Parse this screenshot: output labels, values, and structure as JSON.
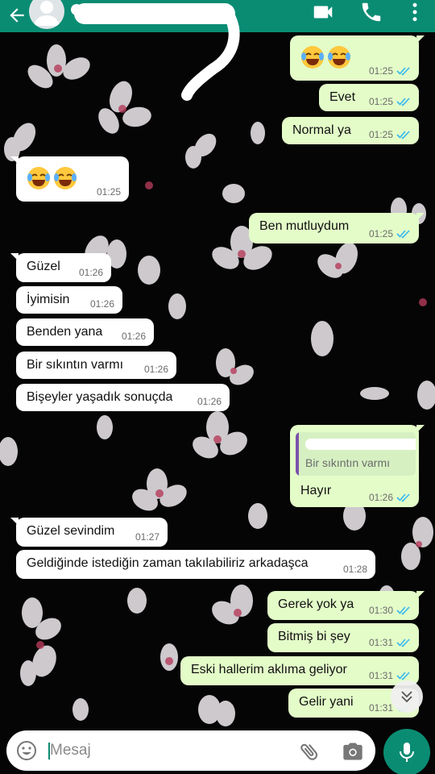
{
  "header": {
    "contact_name": "",
    "icons": [
      "back-arrow-icon",
      "avatar",
      "video-call-icon",
      "phone-icon",
      "more-vert-icon"
    ],
    "color": "#0a8c73"
  },
  "messages": [
    {
      "dir": "out",
      "text": "😂😂",
      "time": "01:25",
      "read": true
    },
    {
      "dir": "out",
      "text": "Evet",
      "time": "01:25",
      "read": true
    },
    {
      "dir": "out",
      "text": "Normal ya",
      "time": "01:25",
      "read": true
    },
    {
      "dir": "in",
      "text": "😂😂",
      "time": "01:25"
    },
    {
      "dir": "out",
      "text": "Ben mutluydum",
      "time": "01:25",
      "read": true
    },
    {
      "dir": "in",
      "text": "Güzel",
      "time": "01:26"
    },
    {
      "dir": "in",
      "text": "İyimisin",
      "time": "01:26"
    },
    {
      "dir": "in",
      "text": "Benden yana",
      "time": "01:26"
    },
    {
      "dir": "in",
      "text": "Bir sıkıntın varmı",
      "time": "01:26"
    },
    {
      "dir": "in",
      "text": "Bişeyler yaşadık sonuçda",
      "time": "01:26"
    },
    {
      "dir": "out",
      "text": "Hayır",
      "time": "01:26",
      "read": true,
      "reply_to": "Bir sıkıntın varmı"
    },
    {
      "dir": "in",
      "text": "Güzel sevindim",
      "time": "01:27"
    },
    {
      "dir": "in",
      "text": "Geldiğinde istediğin zaman takılabiliriz arkadaşca",
      "time": "01:28"
    },
    {
      "dir": "out",
      "text": "Gerek yok ya",
      "time": "01:30",
      "read": true
    },
    {
      "dir": "out",
      "text": "Bitmiş bi şey",
      "time": "01:31",
      "read": true
    },
    {
      "dir": "out",
      "text": "Eski hallerim aklıma geliyor",
      "time": "01:31",
      "read": true
    },
    {
      "dir": "out",
      "text": "Gelir yani",
      "time": "01:31",
      "read": true
    }
  ],
  "composer": {
    "placeholder": "Mesaj",
    "icons": [
      "emoji-icon",
      "attach-icon",
      "camera-icon",
      "mic-icon",
      "scroll-down-icon"
    ]
  },
  "colors": {
    "accent": "#0a8c73",
    "incoming": "#ffffff",
    "outgoing": "#e3fcc8",
    "read_ticks": "#34b7f1"
  }
}
